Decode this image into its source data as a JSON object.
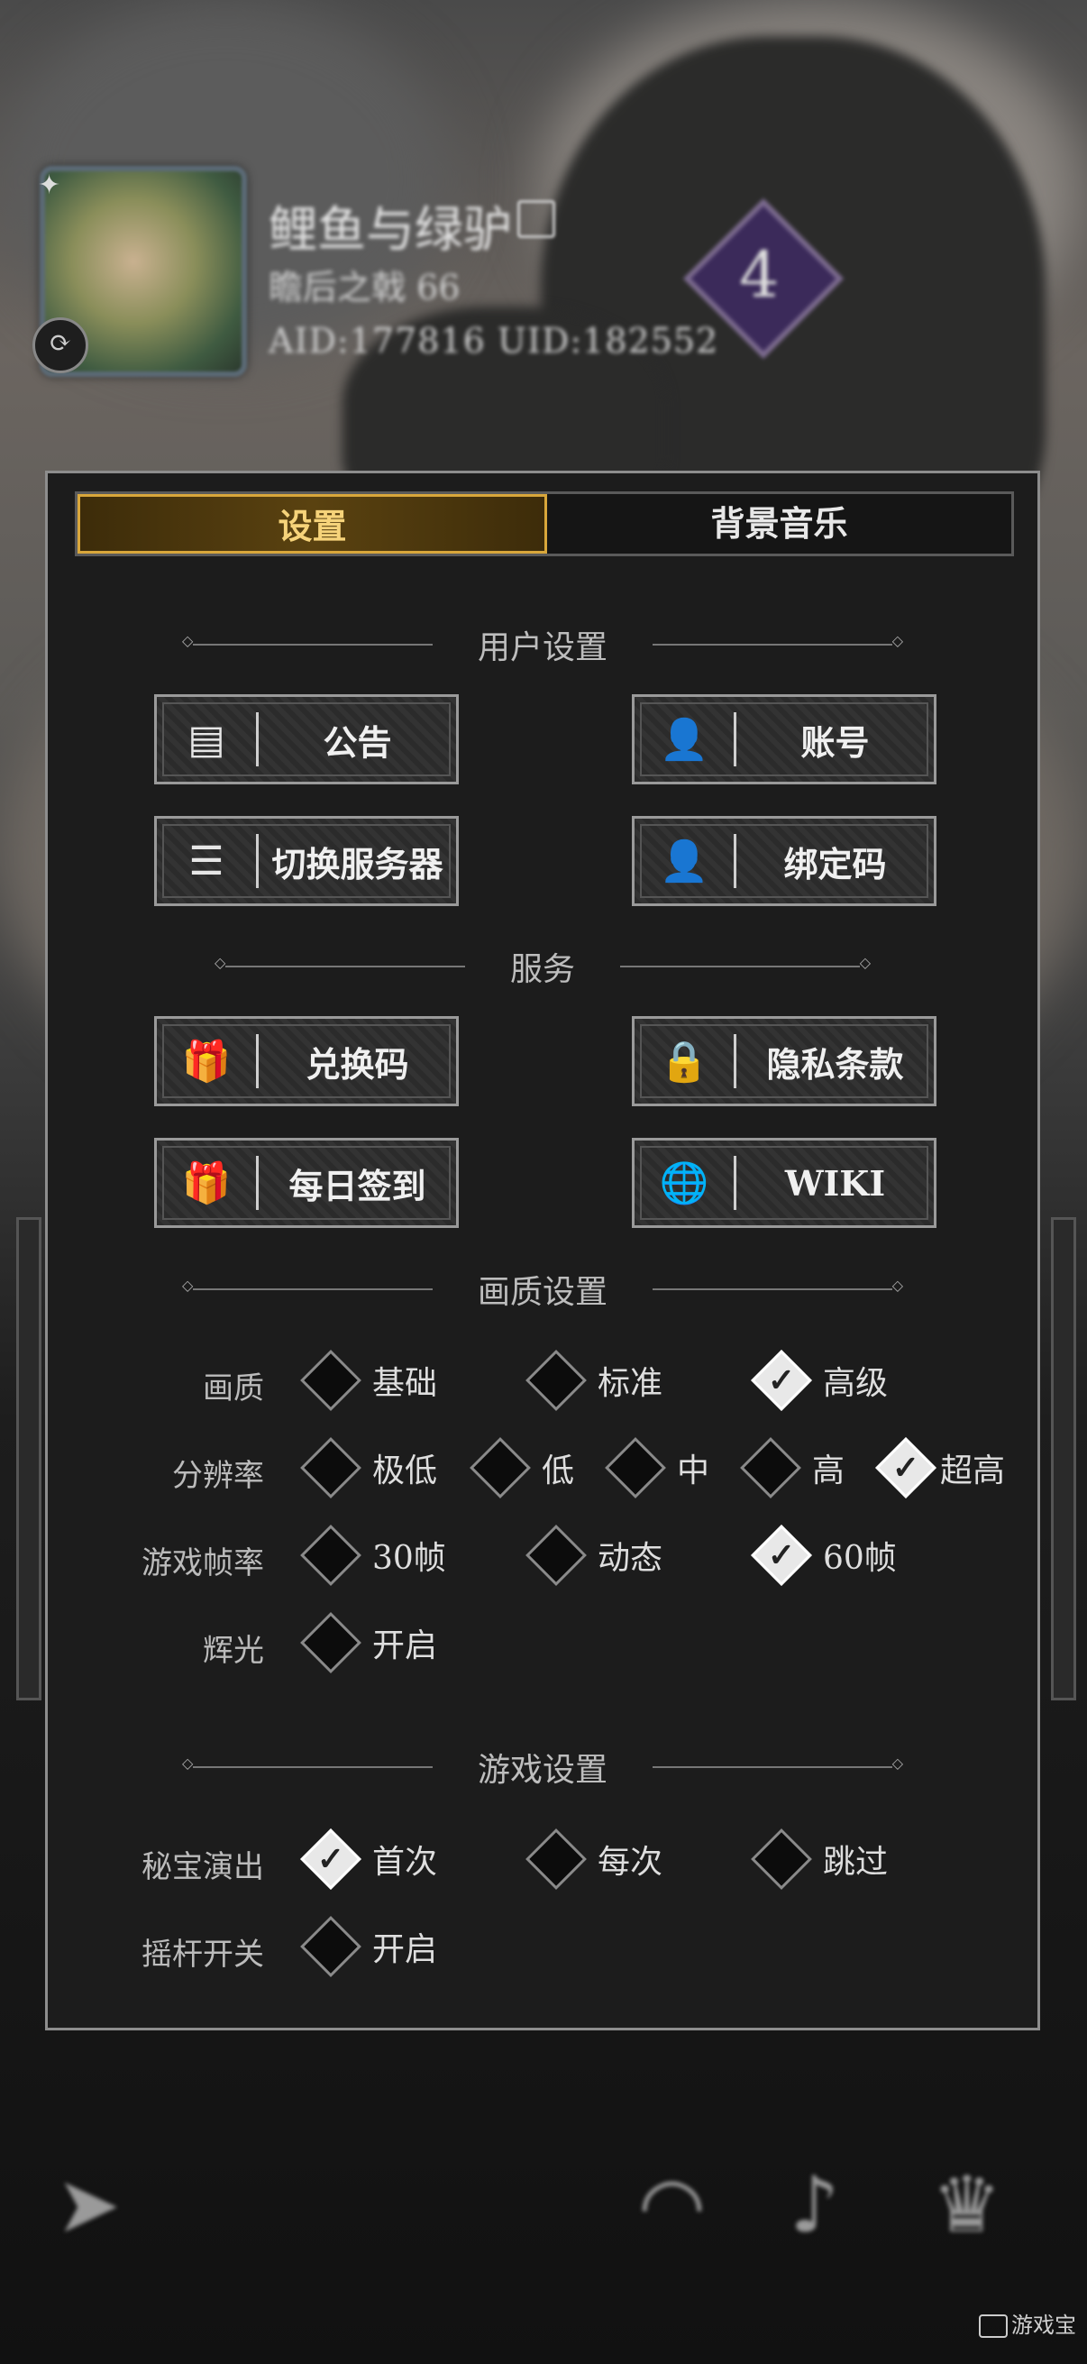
{
  "profile": {
    "name": "鲤鱼与绿驴",
    "title": "瞻后之戟 66",
    "ids": "AID:177816 UID:182552",
    "rank": "4"
  },
  "tabs": [
    {
      "label": "设置",
      "active": true
    },
    {
      "label": "背景音乐",
      "active": false
    }
  ],
  "sections": {
    "user": "用户设置",
    "service": "服务",
    "quality": "画质设置",
    "game": "游戏设置"
  },
  "buttons": {
    "notice": {
      "label": "公告",
      "icon": "document-icon"
    },
    "account": {
      "label": "账号",
      "icon": "user-icon"
    },
    "switch_server": {
      "label": "切换服务器",
      "icon": "list-icon"
    },
    "bind_code": {
      "label": "绑定码",
      "icon": "user-icon"
    },
    "redeem": {
      "label": "兑换码",
      "icon": "gift-icon"
    },
    "privacy": {
      "label": "隐私条款",
      "icon": "lock-document-icon"
    },
    "daily_checkin": {
      "label": "每日签到",
      "icon": "gift-icon"
    },
    "wiki": {
      "label": "WIKI",
      "icon": "wiki-icon"
    }
  },
  "settings": {
    "quality": {
      "label": "画质",
      "options": [
        "基础",
        "标准",
        "高级"
      ],
      "selected": "高级"
    },
    "resolution": {
      "label": "分辨率",
      "options": [
        "极低",
        "低",
        "中",
        "高",
        "超高"
      ],
      "selected": "超高"
    },
    "framerate": {
      "label": "游戏帧率",
      "options": [
        "30帧",
        "动态",
        "60帧"
      ],
      "selected": "60帧"
    },
    "glow": {
      "label": "辉光",
      "options": [
        "开启"
      ],
      "selected": ""
    },
    "treasure": {
      "label": "秘宝演出",
      "options": [
        "首次",
        "每次",
        "跳过"
      ],
      "selected": "首次"
    },
    "joystick": {
      "label": "摇杆开关",
      "options": [
        "开启"
      ],
      "selected": ""
    }
  },
  "watermark": "游戏宝"
}
